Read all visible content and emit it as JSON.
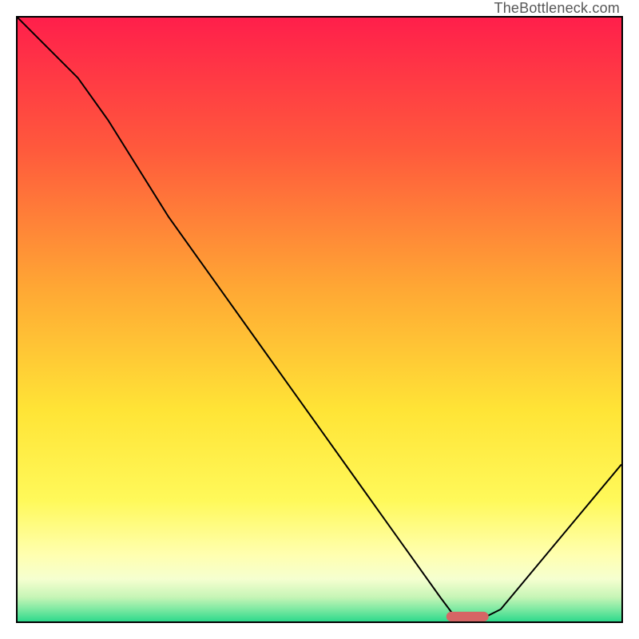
{
  "watermark": "TheBottleneck.com",
  "chart_data": {
    "type": "line",
    "title": "",
    "xlabel": "",
    "ylabel": "",
    "xlim": [
      0,
      100
    ],
    "ylim": [
      0,
      100
    ],
    "series": [
      {
        "name": "curve",
        "x": [
          0,
          5,
          10,
          15,
          20,
          25,
          30,
          35,
          40,
          45,
          50,
          55,
          60,
          65,
          70,
          73,
          76,
          80,
          85,
          90,
          95,
          100
        ],
        "y": [
          100,
          95,
          90,
          83,
          75,
          67,
          60,
          53,
          46,
          39,
          32,
          25,
          18,
          11,
          4,
          0,
          0,
          2,
          8,
          14,
          20,
          26
        ]
      }
    ],
    "marker": {
      "x": 74.5,
      "y": 0,
      "width": 7,
      "height": 1.6,
      "color": "#d66565"
    },
    "gradient_stops": [
      {
        "offset": 0,
        "color": "#ff1f4b"
      },
      {
        "offset": 22,
        "color": "#ff5a3c"
      },
      {
        "offset": 45,
        "color": "#ffa834"
      },
      {
        "offset": 65,
        "color": "#ffe436"
      },
      {
        "offset": 80,
        "color": "#fff95a"
      },
      {
        "offset": 89,
        "color": "#ffffb0"
      },
      {
        "offset": 93,
        "color": "#f5ffd0"
      },
      {
        "offset": 96,
        "color": "#c6f5b6"
      },
      {
        "offset": 98,
        "color": "#7de9a2"
      },
      {
        "offset": 100,
        "color": "#2fd98c"
      }
    ]
  }
}
